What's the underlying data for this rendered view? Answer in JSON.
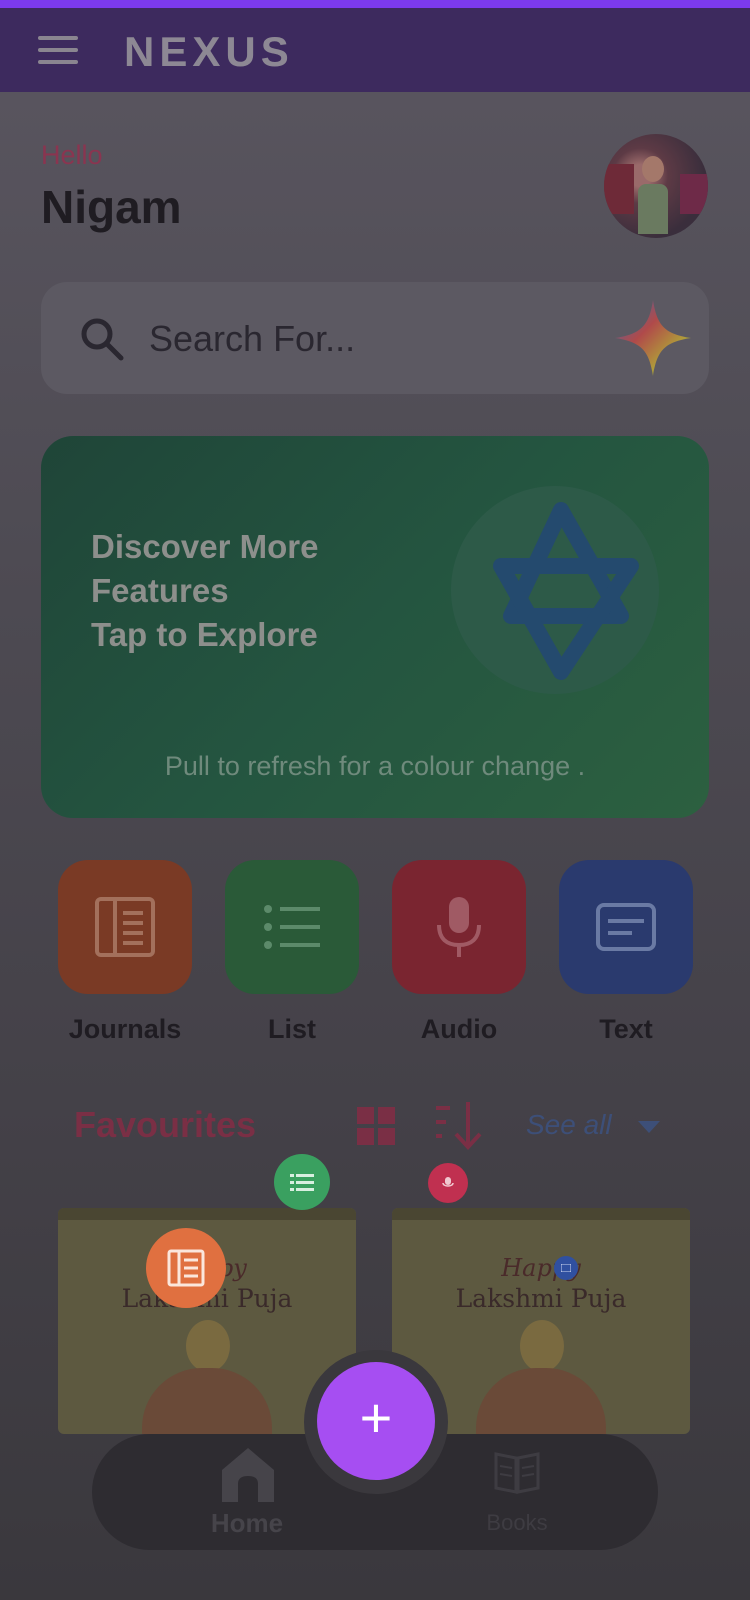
{
  "app": {
    "name": "NEXUS",
    "accent_color": "#7c3aed"
  },
  "greeting": {
    "hello": "Hello",
    "name": "Nigam"
  },
  "search": {
    "placeholder": "Search For..."
  },
  "banner": {
    "line1": "Discover More",
    "line2": "Features",
    "line3": "Tap to Explore",
    "hint": "Pull to refresh for a colour change ."
  },
  "categories": [
    {
      "label": "Journals",
      "icon": "journal-icon",
      "color": "#7a3a25"
    },
    {
      "label": "List",
      "icon": "list-icon",
      "color": "#2a5a38"
    },
    {
      "label": "Audio",
      "icon": "mic-icon",
      "color": "#7a2530"
    },
    {
      "label": "Text",
      "icon": "text-icon",
      "color": "#2a3a6e"
    }
  ],
  "favourites": {
    "title": "Favourites",
    "see_all": "See all",
    "cards": [
      {
        "happy": "Happy",
        "title": "Lakshmi Puja"
      },
      {
        "happy": "Happy",
        "title": "Lakshmi Puja"
      }
    ]
  },
  "fab_menu": {
    "journal_color": "#e07040",
    "list_color": "#3aa060",
    "audio_color": "#c03050",
    "text_color": "#3050a0"
  },
  "bottom_nav": {
    "home": "Home",
    "books": "Books"
  },
  "fab": {
    "label": "+",
    "color": "#a64ef2"
  }
}
